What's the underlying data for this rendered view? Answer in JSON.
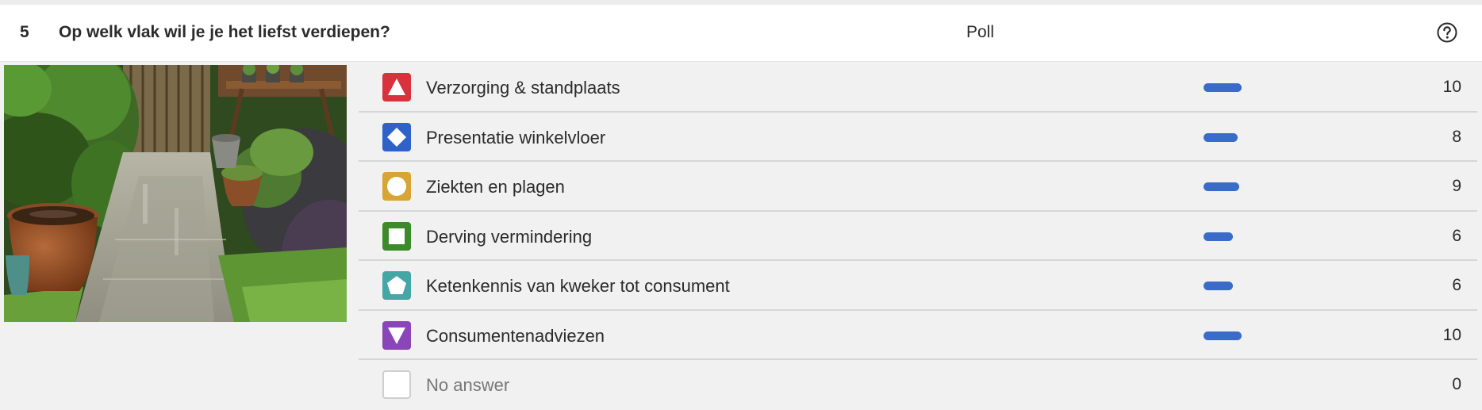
{
  "question": {
    "number": "5",
    "title": "Op welk vlak wil je je het liefst verdiepen?",
    "type": "Poll",
    "help_icon": "question-circle-icon"
  },
  "image": {
    "subject": "garden-photo"
  },
  "colors": {
    "bar": "#3a6bc8",
    "red": "#d8323c",
    "blue": "#2e62c9",
    "gold": "#d6a536",
    "green": "#3c8a2a",
    "teal": "#45a6a6",
    "purple": "#8a46b8"
  },
  "results": {
    "max_count": 10,
    "options": [
      {
        "label": "Verzorging & standplaats",
        "count": 10,
        "icon": "triangle-icon",
        "color": "#d8323c"
      },
      {
        "label": "Presentatie winkelvloer",
        "count": 8,
        "icon": "diamond-icon",
        "color": "#2e62c9"
      },
      {
        "label": "Ziekten en plagen",
        "count": 9,
        "icon": "circle-icon",
        "color": "#d6a536"
      },
      {
        "label": "Derving vermindering",
        "count": 6,
        "icon": "square-icon",
        "color": "#3c8a2a"
      },
      {
        "label": "Ketenkennis van kweker tot consument",
        "count": 6,
        "icon": "pentagon-icon",
        "color": "#45a6a6"
      },
      {
        "label": "Consumentenadviezen",
        "count": 10,
        "icon": "inverted-triangle-icon",
        "color": "#8a46b8"
      },
      {
        "label": "No answer",
        "count": 0,
        "icon": "empty-box-icon",
        "color": "#ffffff"
      }
    ]
  }
}
